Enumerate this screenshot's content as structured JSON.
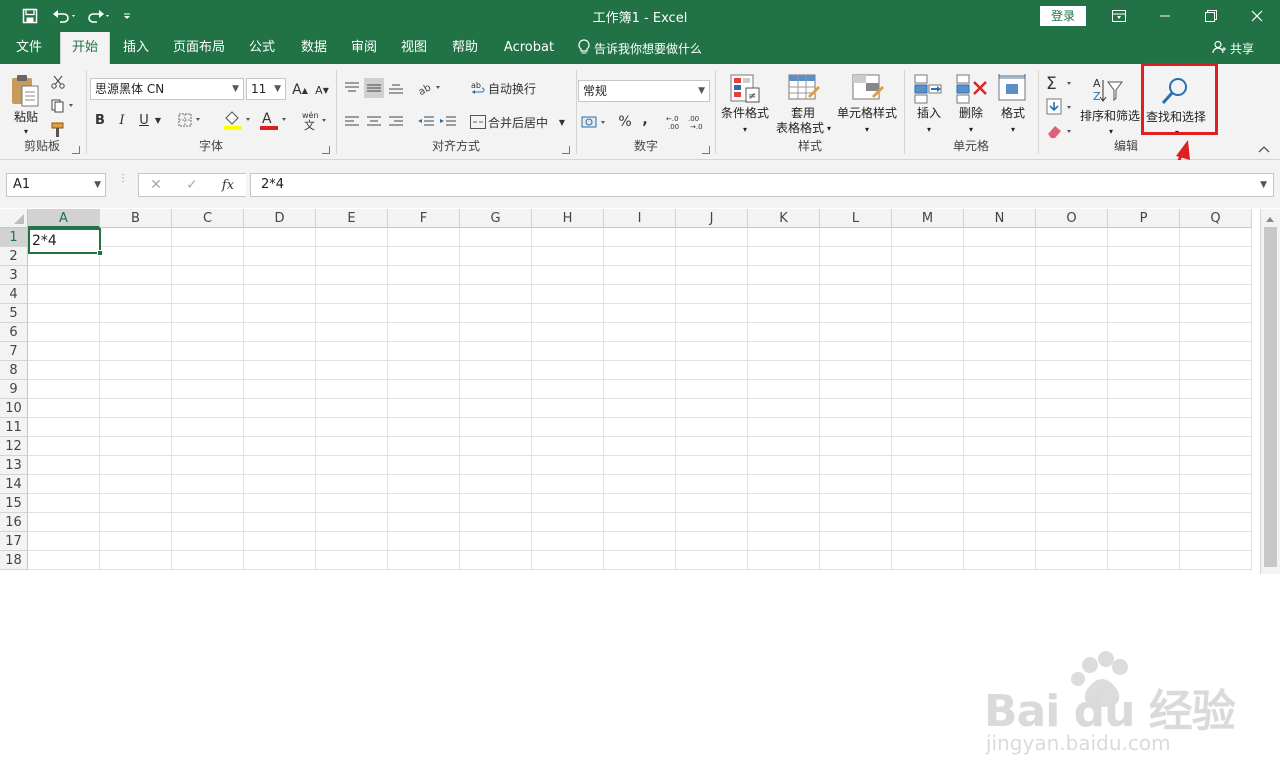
{
  "titlebar": {
    "title": "工作簿1  -  Excel",
    "login_label": "登录",
    "save_icon": "save-icon",
    "undo_icon": "undo-icon",
    "redo_icon": "redo-icon"
  },
  "tabs": [
    {
      "label": "文件"
    },
    {
      "label": "开始"
    },
    {
      "label": "插入"
    },
    {
      "label": "页面布局"
    },
    {
      "label": "公式"
    },
    {
      "label": "数据"
    },
    {
      "label": "审阅"
    },
    {
      "label": "视图"
    },
    {
      "label": "帮助"
    },
    {
      "label": "Acrobat"
    }
  ],
  "tellme": "告诉我你想要做什么",
  "share": "共享",
  "ribbon": {
    "clipboard": {
      "paste": "粘贴",
      "label": "剪贴板"
    },
    "font": {
      "name": "思源黑体 CN",
      "size": "11",
      "bold": "B",
      "italic": "I",
      "underline": "U",
      "grow": "A",
      "shrink": "A",
      "label": "字体"
    },
    "alignment": {
      "wrap": "自动换行",
      "merge": "合并后居中",
      "label": "对齐方式"
    },
    "number": {
      "format": "常规",
      "percent": "%",
      "comma": ",",
      "label": "数字"
    },
    "styles": {
      "conditional": "条件格式",
      "table_line1": "套用",
      "table_line2": "表格格式",
      "cell_styles": "单元格样式",
      "label": "样式"
    },
    "cells": {
      "insert": "插入",
      "delete": "删除",
      "format": "格式",
      "label": "单元格"
    },
    "editing": {
      "sort_filter": "排序和筛选",
      "find_select": "查找和选择",
      "label": "编辑"
    }
  },
  "formula": {
    "namebox": "A1",
    "fx": "fx",
    "content": "2*4"
  },
  "columns": [
    "A",
    "B",
    "C",
    "D",
    "E",
    "F",
    "G",
    "H",
    "I",
    "J",
    "K",
    "L",
    "M",
    "N",
    "O",
    "P",
    "Q"
  ],
  "rows": [
    "1",
    "2",
    "3",
    "4",
    "5",
    "6",
    "7",
    "8",
    "9",
    "10",
    "11",
    "12",
    "13",
    "14",
    "15",
    "16",
    "17",
    "18"
  ],
  "cells": {
    "A1": "2*4"
  },
  "watermark": {
    "brand": "Bai du 经验",
    "url": "jingyan.baidu.com"
  },
  "colors": {
    "accent": "#217346",
    "highlight": "#e02020"
  }
}
